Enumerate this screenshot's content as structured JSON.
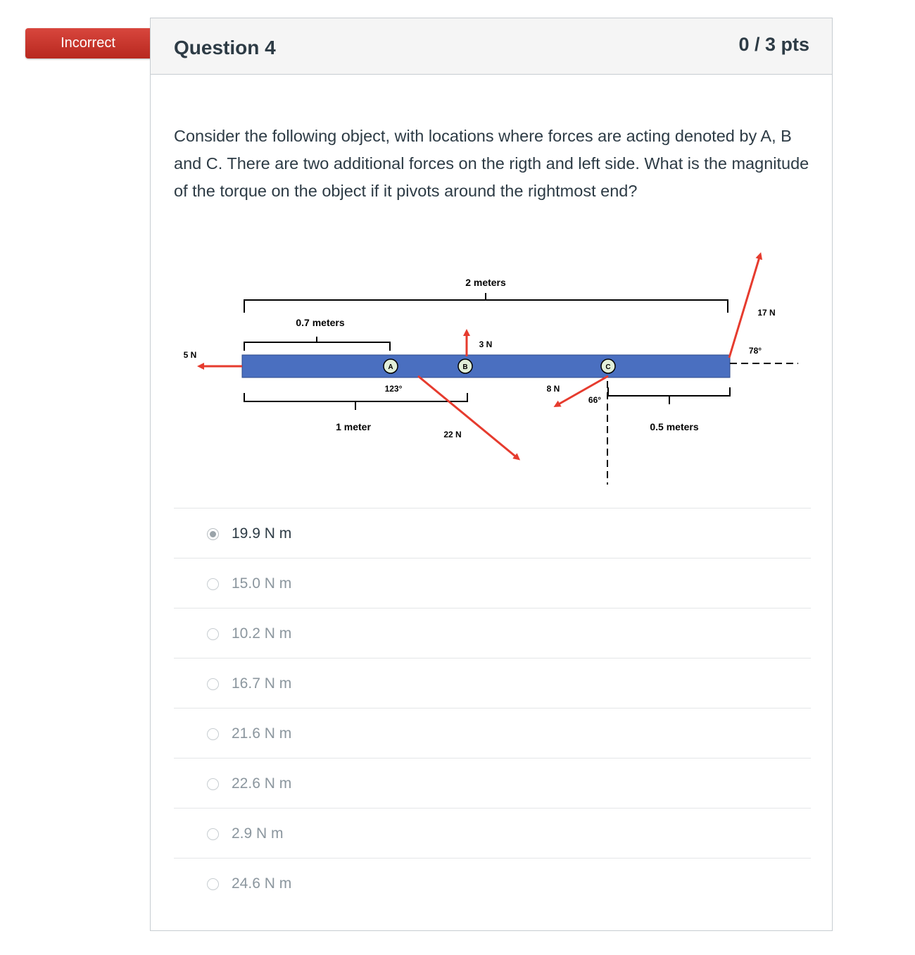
{
  "status": {
    "label": "Incorrect"
  },
  "question": {
    "title": "Question 4",
    "points": "0 / 3 pts",
    "text": "Consider the following object, with locations where forces are acting denoted by A, B and C.  There are two additional forces on the rigth and left side.  What is the magnitude of the torque on the object if it pivots around the rightmost end?"
  },
  "diagram": {
    "labels": {
      "two_meters": "2 meters",
      "point_seven_meters": "0.7 meters",
      "one_meter": "1 meter",
      "point_five_meters": "0.5 meters",
      "five_n": "5 N",
      "three_n": "3 N",
      "twentytwo_n": "22 N",
      "eight_n": "8 N",
      "seventeen_n": "17 N",
      "angle_123": "123°",
      "angle_66": "66°",
      "angle_78": "78°",
      "point_a": "A",
      "point_b": "B",
      "point_c": "C"
    },
    "colors": {
      "beam": "#4a6fc0",
      "force": "#e63b2e",
      "point_fill": "#e2f0d9"
    }
  },
  "answers": [
    {
      "label": "19.9 N m",
      "selected": true
    },
    {
      "label": "15.0 N m",
      "selected": false
    },
    {
      "label": "10.2 N m",
      "selected": false
    },
    {
      "label": "16.7 N m",
      "selected": false
    },
    {
      "label": "21.6 N m",
      "selected": false
    },
    {
      "label": "22.6 N m",
      "selected": false
    },
    {
      "label": "2.9 N m",
      "selected": false
    },
    {
      "label": "24.6 N m",
      "selected": false
    }
  ]
}
